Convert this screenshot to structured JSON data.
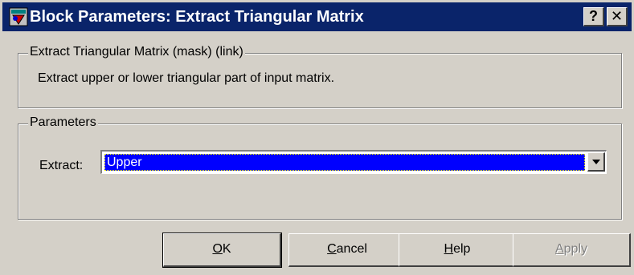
{
  "window": {
    "title": "Block Parameters: Extract Triangular Matrix",
    "help_button": "?",
    "close_button": "✕"
  },
  "mask_group": {
    "label": "Extract Triangular Matrix (mask) (link)",
    "description": "Extract upper or lower triangular part of input matrix."
  },
  "parameters_group": {
    "label": "Parameters",
    "extract_label": "Extract:",
    "extract_value": "Upper"
  },
  "buttons": {
    "ok": {
      "mnemonic": "O",
      "rest": "K"
    },
    "cancel": {
      "mnemonic": "C",
      "rest": "ancel"
    },
    "help": {
      "mnemonic": "H",
      "rest": "elp"
    },
    "apply": {
      "mnemonic": "A",
      "rest": "pply",
      "enabled": false
    }
  },
  "colors": {
    "titlebar": "#0a246a",
    "selection": "#0000ff",
    "face": "#d4d0c8"
  }
}
